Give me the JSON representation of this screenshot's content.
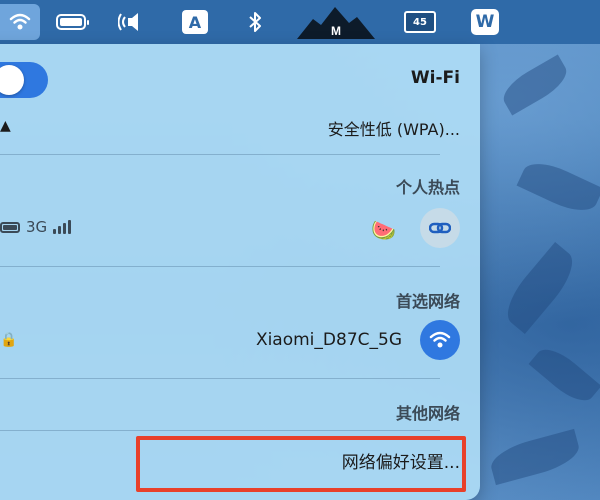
{
  "menubar": {
    "input_method_label": "A",
    "display_badge": "45",
    "w_app_label": "W"
  },
  "wifi_panel": {
    "title": "Wi-Fi",
    "toggle_on": true,
    "current_security": "安全性低 (WPA)...",
    "sections": {
      "hotspot_header": "个人热点",
      "hotspot_network_type": "3G",
      "preferred_header": "首选网络",
      "preferred_network_name": "Xiaomi_D87C_5G",
      "other_header": "其他网络"
    },
    "settings_link": "网络偏好设置..."
  },
  "colors": {
    "panel_bg": "#addbf5",
    "accent_blue": "#2f78e0",
    "highlight_red": "#e8402a",
    "menubar_bg": "#2f6aa8"
  }
}
